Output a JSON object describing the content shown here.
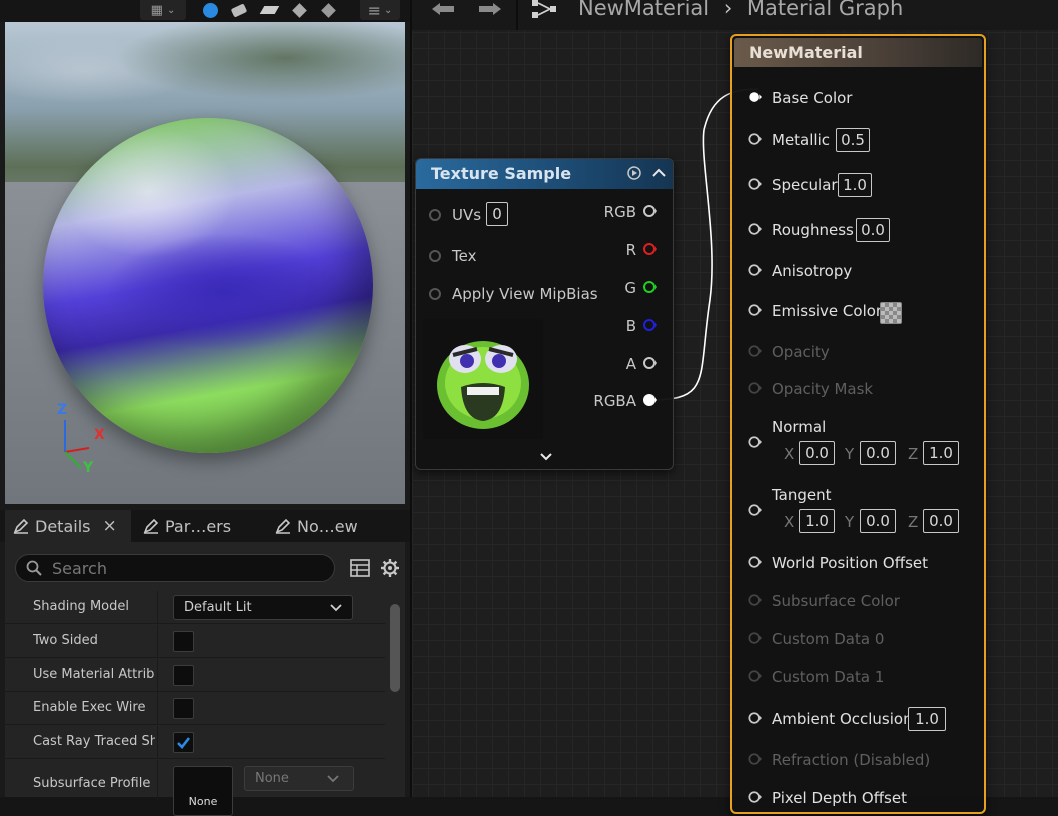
{
  "viewport": {
    "axis_labels": {
      "z": "Z",
      "x": "X",
      "y": "Y"
    }
  },
  "tabs": [
    {
      "label": "Details",
      "close": "×"
    },
    {
      "label": "Par…ers"
    },
    {
      "label": "No…ew"
    }
  ],
  "details": {
    "search_placeholder": "Search",
    "properties": [
      {
        "label": "Shading Model",
        "value": "Default Lit"
      },
      {
        "label": "Two Sided",
        "checked": false
      },
      {
        "label": "Use Material Attrib…",
        "checked": false
      },
      {
        "label": "Enable Exec Wire",
        "checked": false
      },
      {
        "label": "Cast Ray Traced Sh…",
        "checked": true
      },
      {
        "label": "Subsurface Profile",
        "thumb_label": "None",
        "value": "None"
      }
    ]
  },
  "graph": {
    "breadcrumb": {
      "asset": "NewMaterial",
      "separator": "›",
      "page": "Material Graph"
    },
    "texture_node": {
      "title": "Texture Sample",
      "inputs": [
        {
          "label": "UVs",
          "value": "0"
        },
        {
          "label": "Tex"
        },
        {
          "label": "Apply View MipBias"
        }
      ],
      "outputs": [
        {
          "label": "RGB",
          "color": "#c8c8c8"
        },
        {
          "label": "R",
          "color": "#e02020"
        },
        {
          "label": "G",
          "color": "#20d020"
        },
        {
          "label": "B",
          "color": "#2020e0"
        },
        {
          "label": "A",
          "color": "#c8c8c8"
        },
        {
          "label": "RGBA",
          "color": "#ffffff"
        }
      ]
    },
    "material_node": {
      "title": "NewMaterial",
      "accent": "#e8a020",
      "pins": [
        {
          "label": "Base Color",
          "connected": true
        },
        {
          "label": "Metallic",
          "value": "0.5"
        },
        {
          "label": "Specular",
          "value": "1.0"
        },
        {
          "label": "Roughness",
          "value": "0.0"
        },
        {
          "label": "Anisotropy"
        },
        {
          "label": "Emissive Color",
          "swatch": true
        },
        {
          "label": "Opacity",
          "disabled": true
        },
        {
          "label": "Opacity Mask",
          "disabled": true
        },
        {
          "label": "Normal",
          "x": "0.0",
          "y": "0.0",
          "z": "1.0"
        },
        {
          "label": "Tangent",
          "x": "1.0",
          "y": "0.0",
          "z": "0.0"
        },
        {
          "label": "World Position Offset"
        },
        {
          "label": "Subsurface Color",
          "disabled": true
        },
        {
          "label": "Custom Data 0",
          "disabled": true
        },
        {
          "label": "Custom Data 1",
          "disabled": true
        },
        {
          "label": "Ambient Occlusion",
          "value": "1.0"
        },
        {
          "label": "Refraction (Disabled)",
          "disabled": true
        },
        {
          "label": "Pixel Depth Offset"
        }
      ],
      "xyz_labels": {
        "x": "X",
        "y": "Y",
        "z": "Z"
      }
    }
  }
}
